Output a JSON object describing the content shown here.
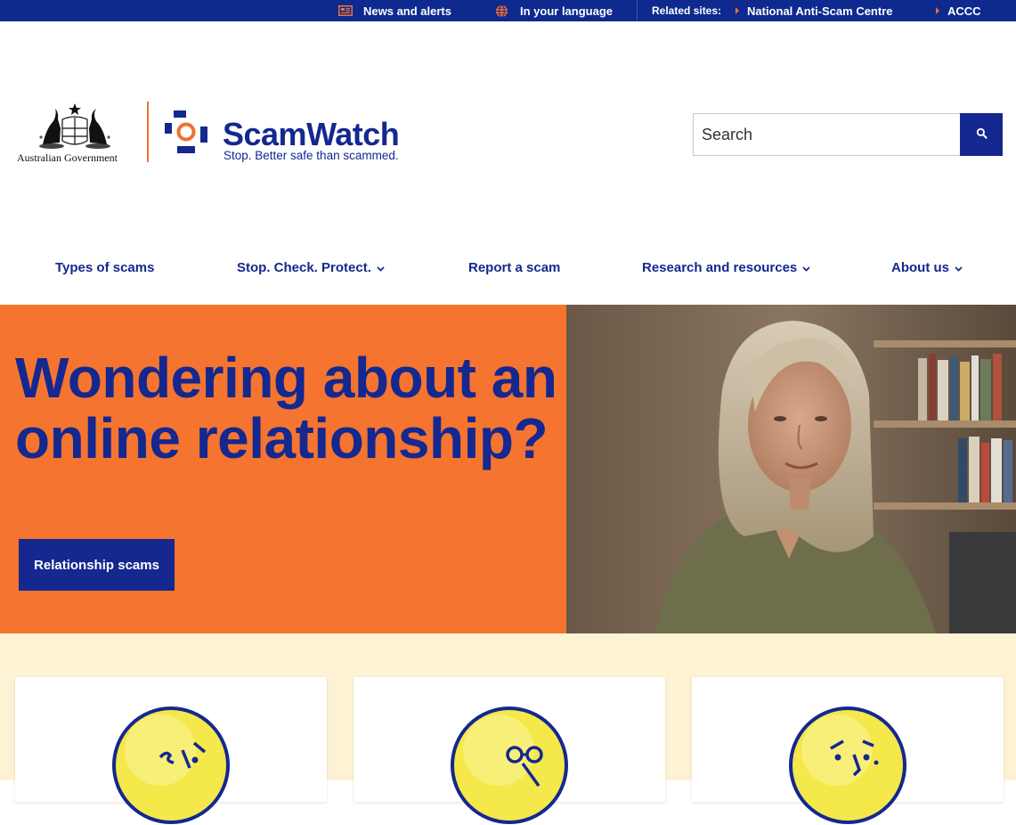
{
  "topbar": {
    "news_label": "News and alerts",
    "language_label": "In your language",
    "related_label": "Related sites:",
    "nasc_label": "National Anti-Scam Centre",
    "accc_label": "ACCC"
  },
  "header": {
    "gov_label": "Australian Government",
    "brand_name": "ScamWatch",
    "tagline": "Stop. Better safe than scammed."
  },
  "search": {
    "placeholder": "Search"
  },
  "nav": {
    "items": [
      {
        "label": "Types of scams"
      },
      {
        "label": "Stop. Check. Protect."
      },
      {
        "label": "Report a scam"
      },
      {
        "label": "Research and resources"
      },
      {
        "label": "About us"
      }
    ]
  },
  "hero": {
    "title": "Wondering about an online relationship?",
    "button_label": "Relationship scams"
  },
  "colors": {
    "navy": "#14288f",
    "orange": "#f5742f",
    "cream": "#fdf3d4",
    "face_yellow": "#f4e84a"
  },
  "icons": [
    "newspaper-icon",
    "globe-icon",
    "search-icon",
    "chevron-down-icon"
  ]
}
